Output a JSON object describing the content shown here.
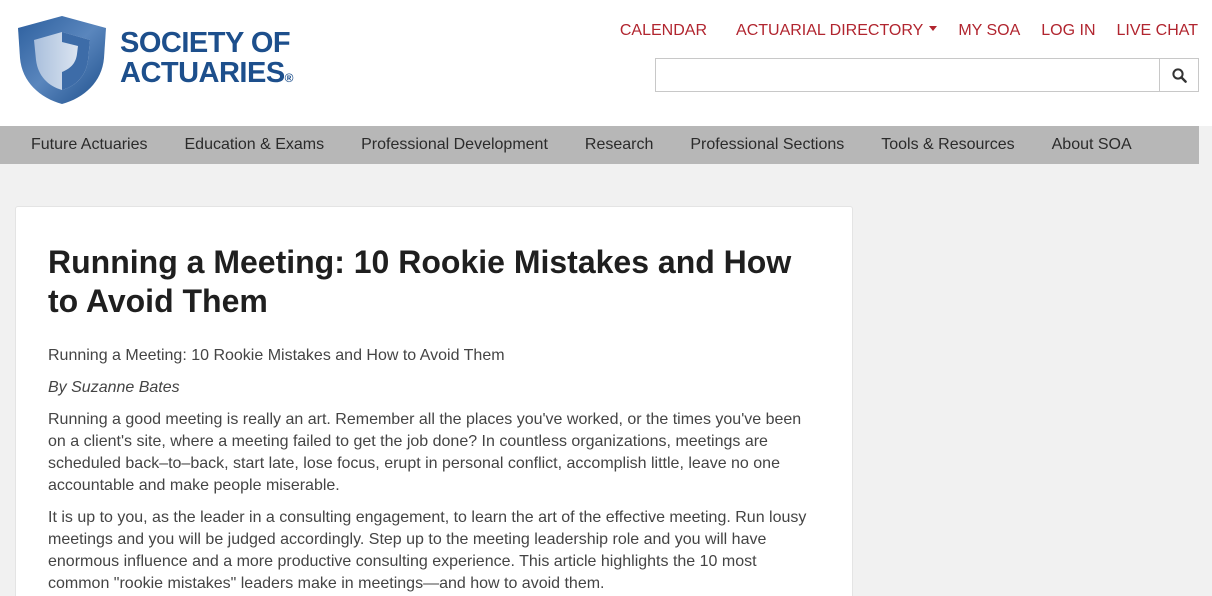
{
  "brand": {
    "name_line1": "SOCIETY OF",
    "name_line2": "ACTUARIES",
    "registered": "®",
    "color": "#1d4f8c"
  },
  "top_links": {
    "calendar": "CALENDAR",
    "directory": "ACTUARIAL DIRECTORY",
    "my_soa": "MY SOA",
    "login": "LOG IN",
    "live_chat": "LIVE CHAT",
    "color": "#b1252f"
  },
  "search": {
    "value": "",
    "placeholder": "",
    "icon": "search-icon"
  },
  "nav": {
    "items": [
      "Future Actuaries",
      "Education & Exams",
      "Professional Development",
      "Research",
      "Professional Sections",
      "Tools & Resources",
      "About SOA"
    ]
  },
  "article": {
    "title": "Running a Meeting: 10 Rookie Mistakes and How to Avoid Them",
    "subtitle": "Running a Meeting: 10 Rookie Mistakes and How to Avoid Them",
    "byline": "By Suzanne Bates",
    "paragraphs": [
      "Running a good meeting is really an art. Remember all the places you've worked, or the times you've been on a client's site, where a meeting failed to get the job done? In countless organizations, meetings are scheduled back–to–back, start late, lose focus, erupt in personal conflict, accomplish little, leave no one accountable and make people miserable.",
      "It is up to you, as the leader in a consulting engagement, to learn the art of the effective meeting. Run lousy meetings and you will be judged accordingly. Step up to the meeting leadership role and you will have enormous influence and a more productive consulting experience. This article highlights the 10 most common \"rookie mistakes\" leaders make in meetings—and how to avoid them."
    ]
  }
}
